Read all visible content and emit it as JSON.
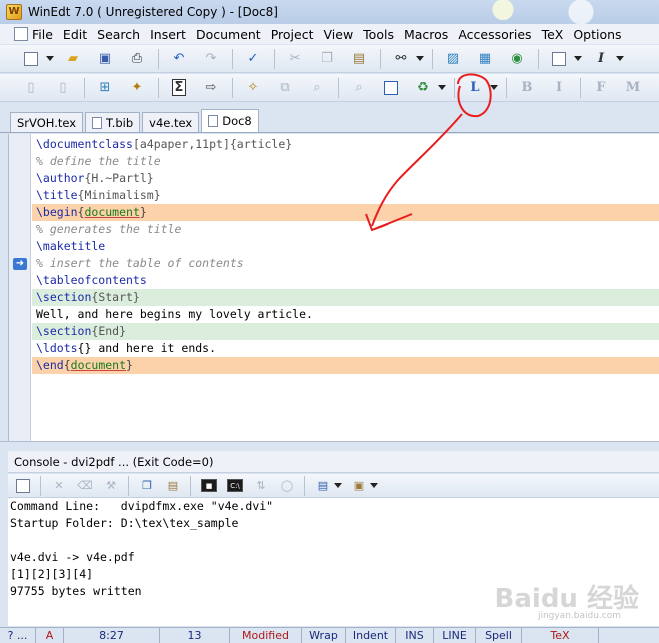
{
  "window": {
    "title": "WinEdt 7.0  ( Unregistered  Copy )  - [Doc8]"
  },
  "menu": [
    "File",
    "Edit",
    "Search",
    "Insert",
    "Document",
    "Project",
    "View",
    "Tools",
    "Macros",
    "Accessories",
    "TeX",
    "Options"
  ],
  "toolbar2": {
    "latex_button": "L",
    "bold": "B",
    "italic": "I",
    "font": "F",
    "math": "M",
    "sum": "Σ"
  },
  "toolbar1": {
    "italic": "I"
  },
  "tabs": [
    "SrVOH.tex",
    "T.bib",
    "v4e.tex",
    "Doc8"
  ],
  "editor": {
    "lines": [
      {
        "a": "\\documentclass",
        "b": "[a4paper,11pt]",
        "c": "{article}"
      },
      {
        "t": "% define the title"
      },
      {
        "a": "\\author",
        "b": "{H.~Partl}"
      },
      {
        "a": "\\title",
        "b": "{Minimalism}"
      },
      {
        "a": "\\begin",
        "b": "document"
      },
      {
        "t": "% generates the title"
      },
      {
        "a": "\\maketitle"
      },
      {
        "t": "% insert the table of contents"
      },
      {
        "a": "\\tableofcontents"
      },
      {
        "a": "\\section",
        "b": "{Start}"
      },
      {
        "t": "Well, and here begins my lovely article."
      },
      {
        "a": "\\section",
        "b": "{End}"
      },
      {
        "a": "\\ldots",
        "b": "{} and here it ends."
      },
      {
        "a": "\\end",
        "b": "document"
      }
    ]
  },
  "console": {
    "title": "Console - dvi2pdf ... (Exit Code=0)",
    "lines": [
      "Command Line:   dvipdfmx.exe \"v4e.dvi\"",
      "Startup Folder: D:\\tex\\tex_sample",
      "",
      "v4e.dvi -> v4e.pdf",
      "[1][2][3][4]",
      "97755 bytes written"
    ]
  },
  "status": {
    "help": "? ...",
    "mode": "A",
    "position": "8:27",
    "lines": "13",
    "modified": "Modified",
    "wrap": "Wrap",
    "indent": "Indent",
    "ins": "INS",
    "line": "LINE",
    "spell": "Spell",
    "tex": "TeX"
  },
  "watermark": {
    "text": "Baidu 经验",
    "sub": "jingyan.baidu.com"
  },
  "colors": {
    "current_line": "#fcd2ab",
    "section_line": "#dbeede",
    "annotation": "#e81e1e"
  }
}
